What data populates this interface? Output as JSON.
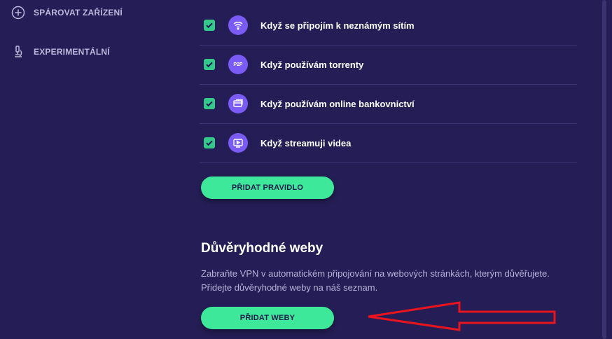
{
  "sidebar": {
    "items": [
      {
        "label": "SPÁROVAT ZAŘÍZENÍ",
        "icon": "plus-circle-icon"
      },
      {
        "label": "EXPERIMENTÁLNÍ",
        "icon": "microscope-icon"
      }
    ]
  },
  "rules": {
    "items": [
      {
        "label": "Když se připojím k neznámým sítím",
        "icon": "wifi-icon",
        "checked": true
      },
      {
        "label": "Když používám torrenty",
        "icon": "p2p-icon",
        "icon_text": "P2P",
        "checked": true
      },
      {
        "label": "Když používám online bankovnictví",
        "icon": "card-icon",
        "checked": true
      },
      {
        "label": "Když streamuji videa",
        "icon": "play-icon",
        "checked": true
      }
    ],
    "add_rule_button": "PŘIDAT PRAVIDLO"
  },
  "trusted": {
    "title": "Důvěryhodné weby",
    "description_line1": "Zabraňte VPN v automatickém připojování na webových stránkách, kterým důvěřujete.",
    "description_line2": "Přidejte důvěryhodné weby na náš seznam.",
    "add_sites_button": "PŘIDAT WEBY"
  },
  "colors": {
    "background": "#251e56",
    "accent_green": "#3ee89a",
    "checkbox_green": "#33c98b",
    "icon_purple": "#7a5bf5",
    "annotation_red": "#e8141e"
  }
}
